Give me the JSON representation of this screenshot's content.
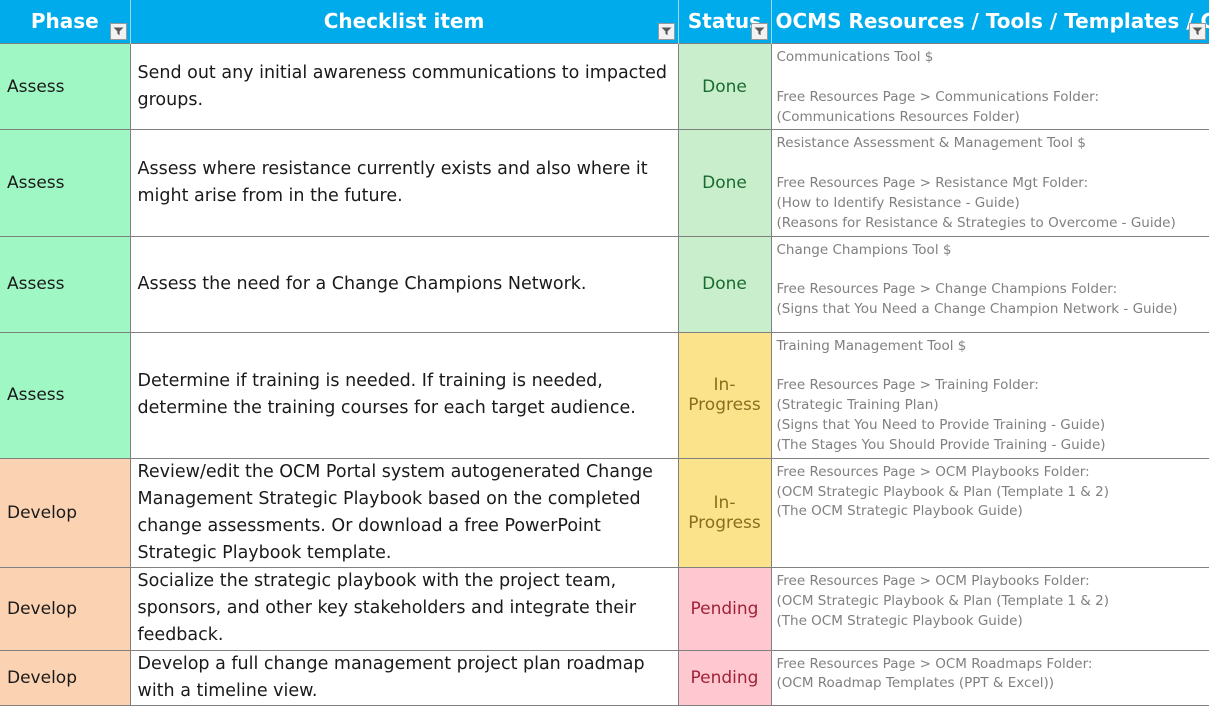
{
  "table": {
    "columns": [
      {
        "id": "phase",
        "label": "Phase",
        "filter_icon": "filter-icon"
      },
      {
        "id": "item",
        "label": "Checklist item",
        "filter_icon": "filter-icon"
      },
      {
        "id": "status",
        "label": "Status",
        "filter_icon": "filter-icon"
      },
      {
        "id": "resources",
        "label": "OCMS Resources / Tools / Templates / Guides",
        "filter_icon": "filter-icon"
      }
    ],
    "colors": {
      "header_background": "#00ABEB",
      "header_text": "#FFFFFF",
      "phase_assess_background": "#9FF7C4",
      "phase_develop_background": "#FBD2B2",
      "status_done_background": "#C8EECB",
      "status_done_text": "#1A6B30",
      "status_in_progress_background": "#FBE38B",
      "status_in_progress_text": "#8A6D1F",
      "status_pending_background": "#FFC7CF",
      "status_pending_text": "#9E2238",
      "resources_text": "#808080",
      "grid_line": "#808080"
    },
    "rows": [
      {
        "phase": "Assess",
        "item": "Send out any initial awareness communications to impacted groups.",
        "status": "Done",
        "resources": "Communications Tool $\n\nFree Resources Page > Communications Folder:\n(Communications Resources Folder)"
      },
      {
        "phase": "Assess",
        "item": "Assess where resistance currently exists and also where it might arise from in the future.",
        "status": "Done",
        "resources": "Resistance Assessment & Management Tool $\n\nFree Resources Page > Resistance Mgt Folder:\n(How to Identify Resistance - Guide)\n(Reasons for Resistance & Strategies to Overcome - Guide)"
      },
      {
        "phase": "Assess",
        "item": "Assess the need for a Change Champions Network.",
        "status": "Done",
        "resources": "Change Champions Tool $\n\nFree Resources Page > Change Champions Folder:\n(Signs that You Need a Change Champion Network - Guide)"
      },
      {
        "phase": "Assess",
        "item": "Determine if training is needed. If training is needed, determine the training courses for each target audience.",
        "status": "In-Progress",
        "resources": "Training Management Tool $\n\nFree Resources Page > Training Folder:\n(Strategic Training Plan)\n(Signs that You Need to Provide Training - Guide)\n(The Stages You Should Provide Training - Guide)"
      },
      {
        "phase": "Develop",
        "item": "Review/edit the OCM Portal system autogenerated Change Management Strategic Playbook based on the completed change assessments. Or download a free PowerPoint Strategic Playbook template.",
        "status": "In-Progress",
        "resources": "Free Resources Page > OCM Playbooks Folder:\n(OCM Strategic Playbook & Plan (Template 1 & 2)\n(The OCM Strategic Playbook Guide)"
      },
      {
        "phase": "Develop",
        "item": "Socialize the strategic playbook with the project team, sponsors, and other key stakeholders and integrate their feedback.",
        "status": "Pending",
        "resources": "Free Resources Page > OCM Playbooks Folder:\n(OCM Strategic Playbook & Plan (Template 1 & 2)\n(The OCM Strategic Playbook Guide)"
      },
      {
        "phase": "Develop",
        "item": "Develop a full change management project plan roadmap with a timeline view.",
        "status": "Pending",
        "resources": "Free Resources Page > OCM Roadmaps Folder:\n(OCM Roadmap Templates (PPT & Excel))"
      }
    ]
  }
}
